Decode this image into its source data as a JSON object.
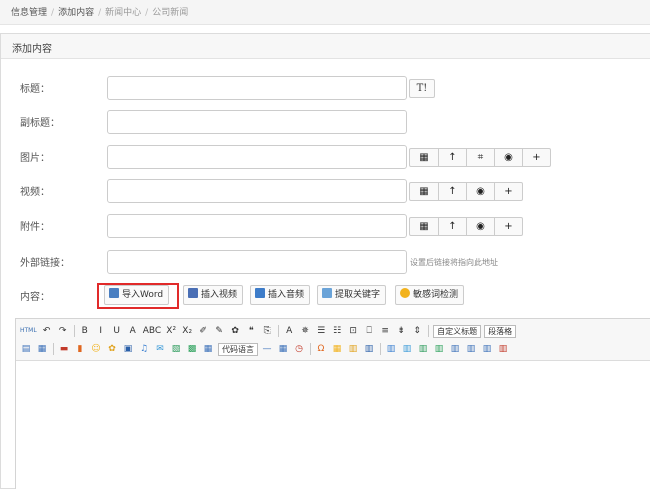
{
  "breadcrumb": {
    "items": [
      "信息管理",
      "添加内容",
      "新闻中心",
      "公司新闻"
    ]
  },
  "panel": {
    "title": "添加内容"
  },
  "form": {
    "title": {
      "label": "标题：",
      "value": "",
      "font_btn": "T!"
    },
    "subtitle": {
      "label": "副标题：",
      "value": ""
    },
    "image": {
      "label": "图片：",
      "value": "",
      "buttons": [
        "▦",
        "↑",
        "⌗",
        "◉",
        "+"
      ]
    },
    "video": {
      "label": "视频：",
      "value": "",
      "buttons": [
        "▦",
        "↑",
        "◉",
        "+"
      ]
    },
    "attachment": {
      "label": "附件：",
      "value": "",
      "buttons": [
        "▦",
        "↑",
        "◉",
        "+"
      ]
    },
    "link": {
      "label": "外部链接：",
      "value": "",
      "hint": "设置后链接将指向此地址"
    },
    "content": {
      "label": "内容："
    }
  },
  "content_tools": [
    {
      "label": "导入Word",
      "icon": "word-icon",
      "color": "#4a7fc1"
    },
    {
      "label": "插入视频",
      "icon": "video-icon",
      "color": "#4a6fb5"
    },
    {
      "label": "插入音频",
      "icon": "audio-icon",
      "color": "#3d7cc9"
    },
    {
      "label": "提取关键字",
      "icon": "tag-icon",
      "color": "#6aa3d8"
    },
    {
      "label": "敏感词检测",
      "icon": "sensitive-icon",
      "color": "#f2b21c"
    }
  ],
  "editor": {
    "toolbar_row1": {
      "left": [
        "HTML",
        "↶",
        "↷",
        "B",
        "I",
        "U",
        "A",
        "ABC",
        "X²",
        "X₂",
        "✐",
        "✎",
        "✿",
        "❝",
        "⎘",
        "A",
        "✵",
        "☰",
        "☷",
        "⊡",
        "⎕",
        "≡",
        "⇟",
        "⇕"
      ],
      "selects": [
        "自定义标题",
        "段落格"
      ]
    },
    "toolbar_row2": {
      "select": "代码语言",
      "icons": [
        "▤",
        "▦",
        "▬",
        "▮",
        "☺",
        "✿",
        "▣",
        "♫",
        "✉",
        "▧",
        "▩",
        "▦",
        "—",
        "▦",
        "◷",
        "Ω",
        "▦",
        "▥",
        "▥",
        "▥",
        "▥",
        "▥",
        "▥",
        "▥",
        "▥",
        "▥",
        "▥"
      ]
    }
  },
  "colors": {
    "highlight": "#e12a2a",
    "panel_bg": "#f7f7f7",
    "border": "#cccccc"
  }
}
